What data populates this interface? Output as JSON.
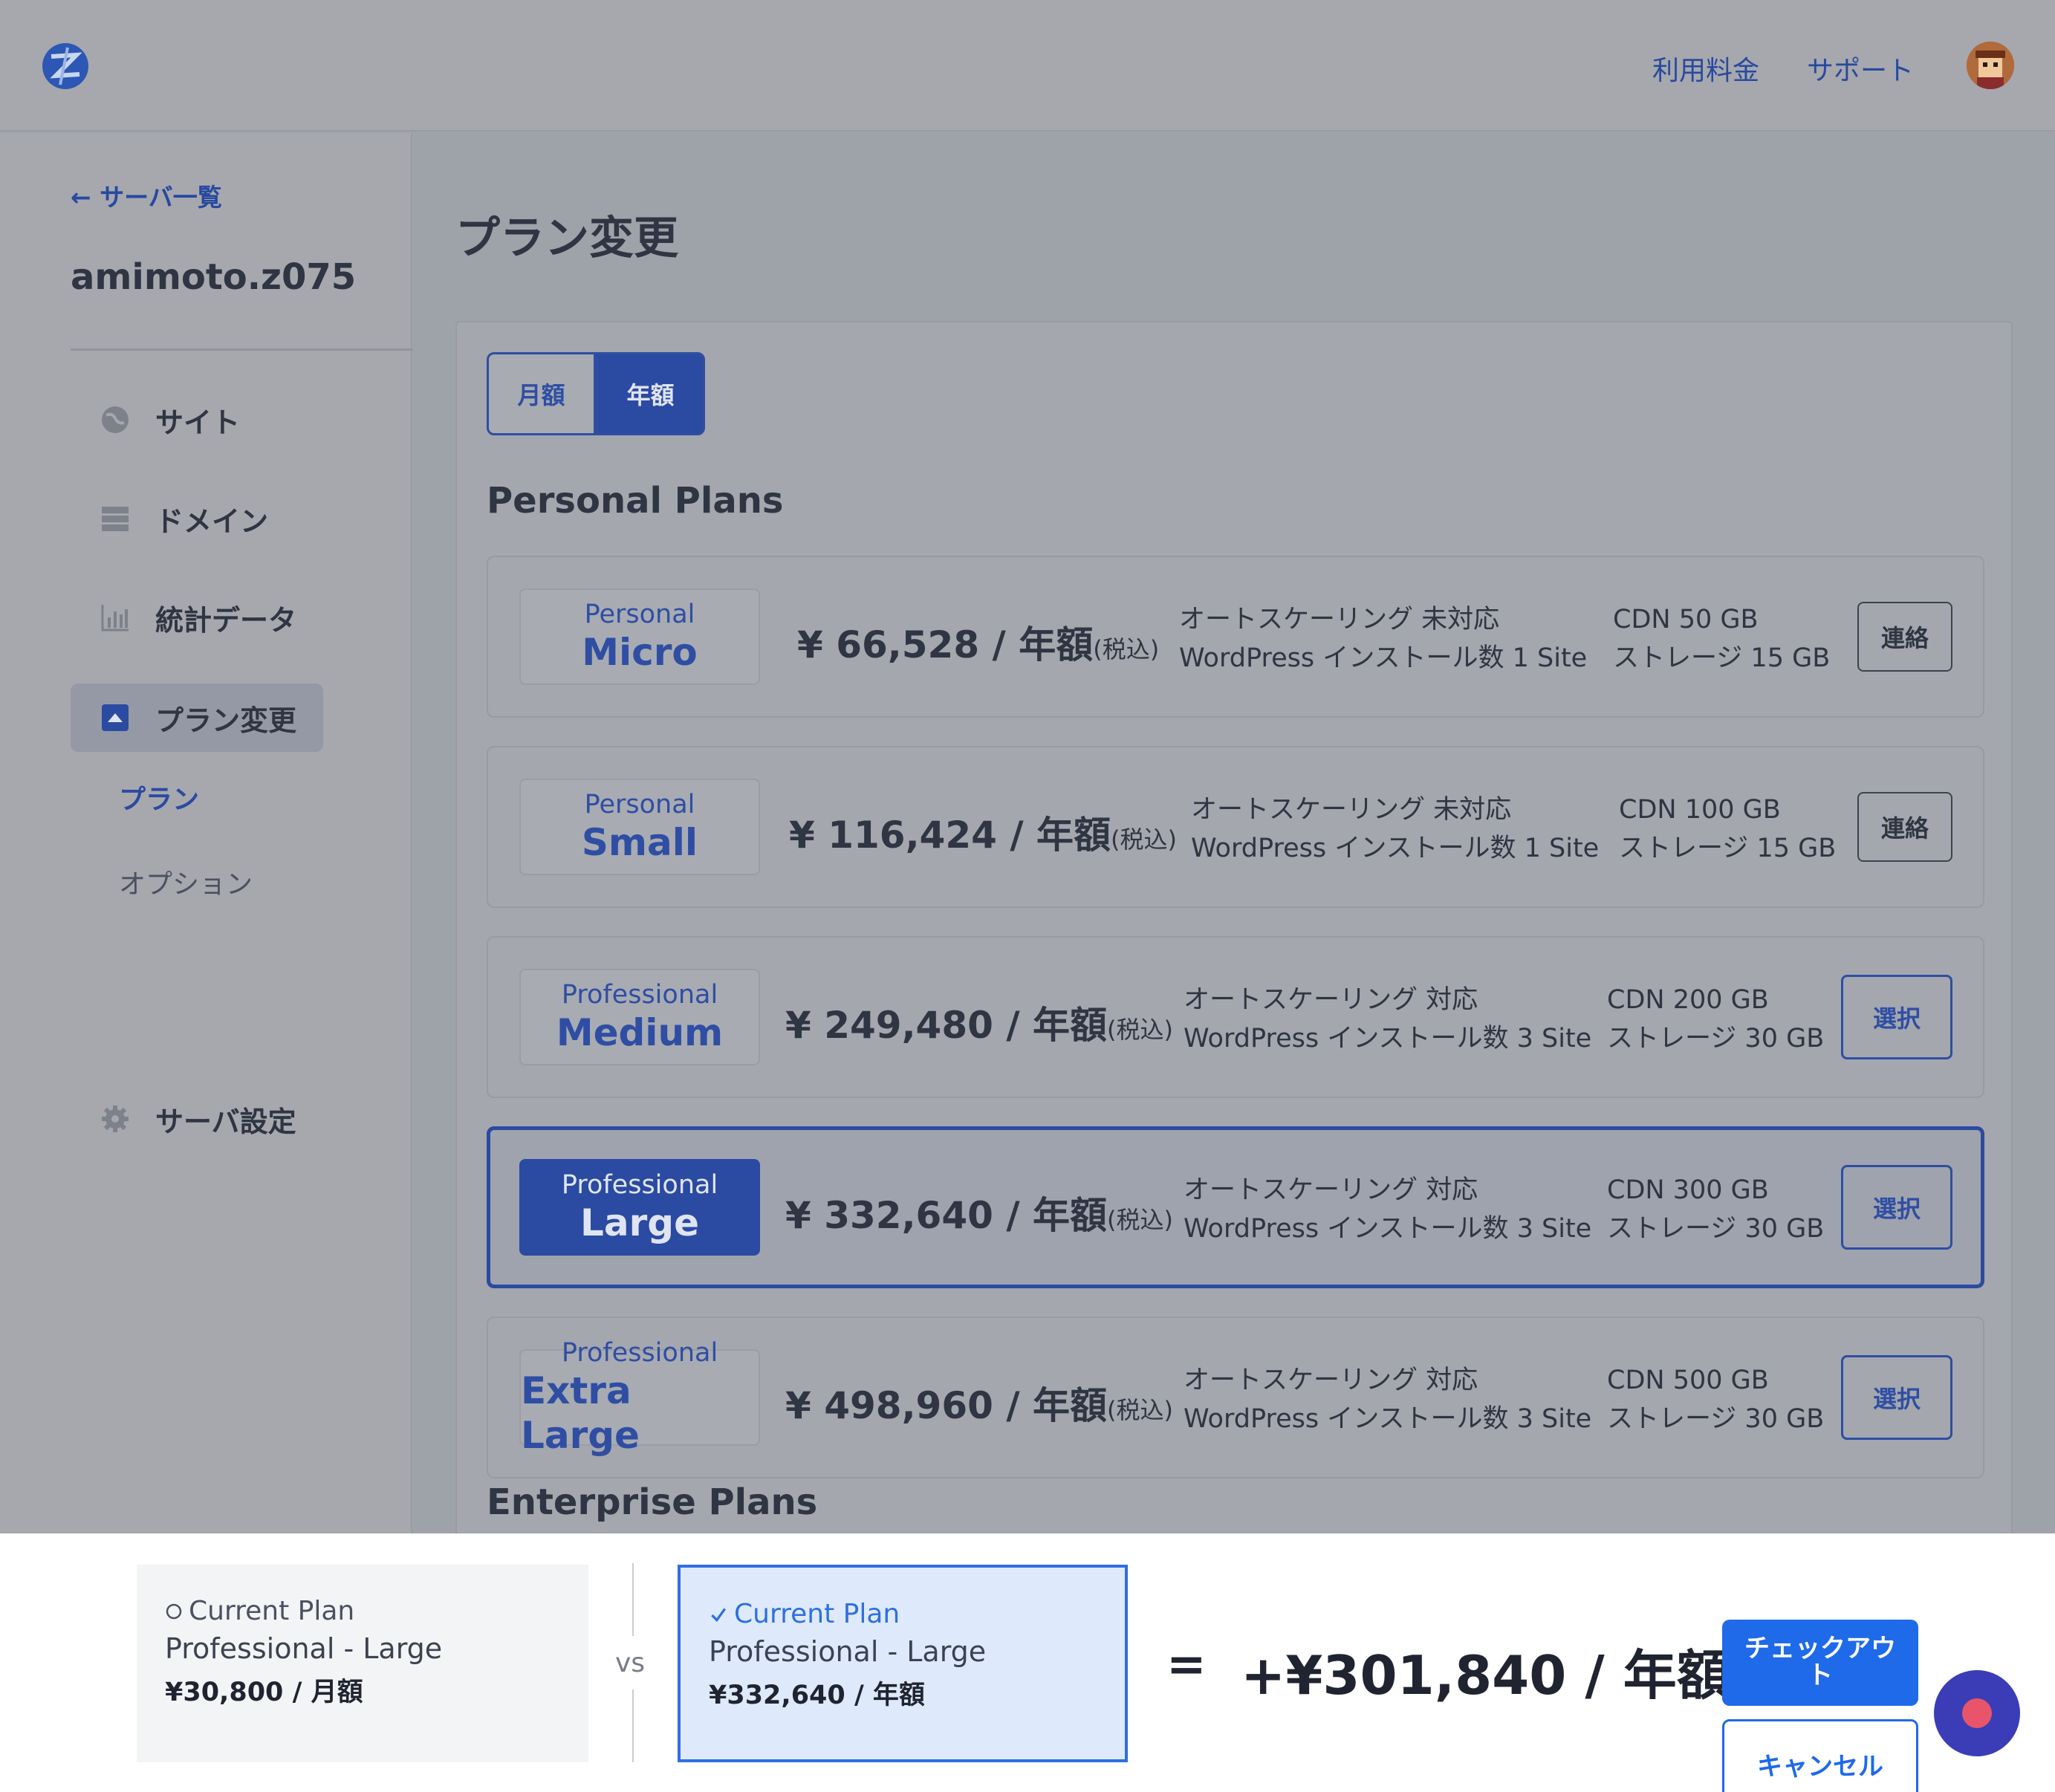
{
  "header": {
    "nav": [
      "利用料金",
      "サポート"
    ]
  },
  "sidebar": {
    "back_label": "← サーバ一覧",
    "server_name": "amimoto.z075",
    "items": [
      {
        "label": "サイト",
        "icon": "globe-icon"
      },
      {
        "label": "ドメイン",
        "icon": "server-icon"
      },
      {
        "label": "統計データ",
        "icon": "bar-chart-icon"
      },
      {
        "label": "プラン変更",
        "icon": "upload-box-icon"
      },
      {
        "label": "サーバ設定",
        "icon": "gear-icon"
      }
    ],
    "sub_items": [
      "プラン",
      "オプション"
    ]
  },
  "main": {
    "title": "プラン変更",
    "billing_toggle": {
      "monthly": "月額",
      "yearly": "年額",
      "selected": "yearly"
    },
    "personal_section": "Personal Plans",
    "enterprise_section": "Enterprise Plans",
    "plans": [
      {
        "tier": "Personal",
        "size": "Micro",
        "price": "¥ 66,528 / 年額",
        "tax": "(税込)",
        "autoscale": "オートスケーリング 未対応",
        "wp": "WordPress インストール数 1 Site",
        "cdn": "CDN 50 GB",
        "storage": "ストレージ 15 GB",
        "action": "連絡"
      },
      {
        "tier": "Personal",
        "size": "Small",
        "price": "¥ 116,424 / 年額",
        "tax": "(税込)",
        "autoscale": "オートスケーリング 未対応",
        "wp": "WordPress インストール数 1 Site",
        "cdn": "CDN 100 GB",
        "storage": "ストレージ 15 GB",
        "action": "連絡"
      },
      {
        "tier": "Professional",
        "size": "Medium",
        "price": "¥ 249,480 / 年額",
        "tax": "(税込)",
        "autoscale": "オートスケーリング 対応",
        "wp": "WordPress インストール数 3 Site",
        "cdn": "CDN 200 GB",
        "storage": "ストレージ 30 GB",
        "action": "選択"
      },
      {
        "tier": "Professional",
        "size": "Large",
        "price": "¥ 332,640 / 年額",
        "tax": "(税込)",
        "autoscale": "オートスケーリング 対応",
        "wp": "WordPress インストール数 3 Site",
        "cdn": "CDN 300 GB",
        "storage": "ストレージ 30 GB",
        "action": "選択"
      },
      {
        "tier": "Professional",
        "size": "Extra Large",
        "price": "¥ 498,960 / 年額",
        "tax": "(税込)",
        "autoscale": "オートスケーリング 対応",
        "wp": "WordPress インストール数 3 Site",
        "cdn": "CDN 500 GB",
        "storage": "ストレージ 30 GB",
        "action": "選択"
      }
    ]
  },
  "footer": {
    "current": {
      "heading": "Current Plan",
      "plan": "Professional - Large",
      "price": "¥30,800 / 月額"
    },
    "vs": "vs",
    "new": {
      "heading": "Current Plan",
      "plan": "Professional - Large",
      "price": "¥332,640 / 年額"
    },
    "equals": "=",
    "difference": "+¥301,840 / 年額",
    "checkout": "チェックアウト",
    "cancel": "キャンセル"
  },
  "colors": {
    "brand_blue": "#2b4aa1",
    "checkout_blue": "#1f6ae8"
  }
}
